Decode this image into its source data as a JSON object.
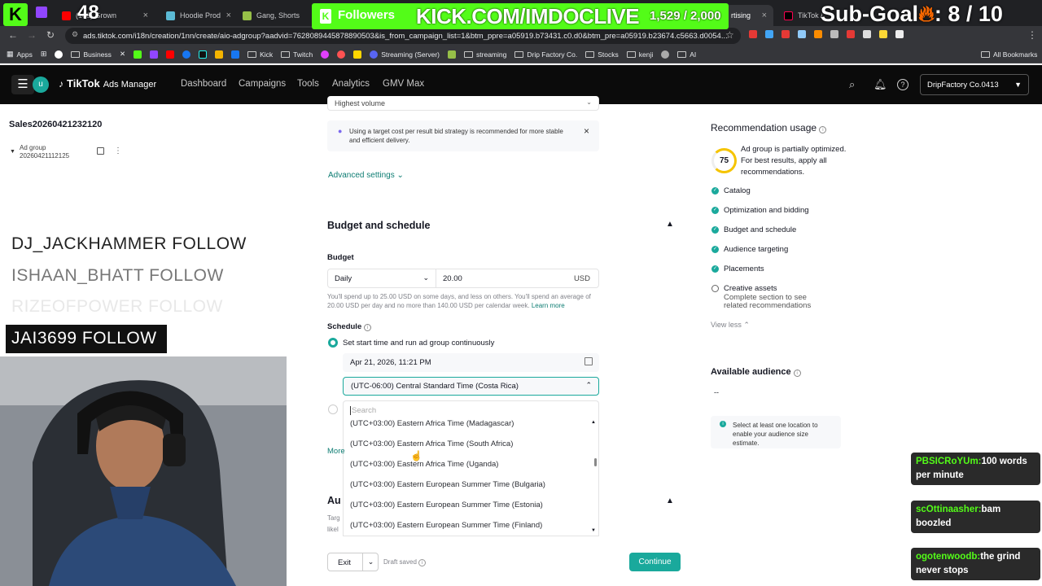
{
  "browser": {
    "tabs": [
      {
        "label": "(103) Grown",
        "color": "#ff0000"
      },
      {
        "label": "Hoodie Prod",
        "color": "#5bbad5"
      },
      {
        "label": "Gang, Shorts",
        "color": "#96bf48"
      },
      {
        "label": "rtising",
        "color": "#000000"
      },
      {
        "label": "TikTok Ad",
        "color": "#000000"
      }
    ],
    "url": "ads.tiktok.com/i18n/creation/1nn/create/aio-adgroup?aadvid=7628089445878890503&is_from_campaign_list=1&btm_ppre=a05919.b73431.c0.d0&btm_pre=a05919.b23674.c5663.d0054...",
    "bookmarks": [
      "Apps",
      "Business",
      "Kick",
      "Twitch",
      "Streaming (Server)",
      "streaming",
      "Drip Factory Co.",
      "Stocks",
      "kenji",
      "AI"
    ],
    "all_bookmarks": "All Bookmarks"
  },
  "stream_overlay": {
    "kick_count": "48",
    "followers_label": "Followers",
    "url": "KICK.COM/IMDOCLIVE",
    "followers_count": "1,529 / 2,000",
    "subgoal_label": "Sub-Goal",
    "subgoal_count": ": 8 / 10",
    "follows": [
      "DJ_JACKHAMMER  FOLLOW",
      "ISHAAN_BHATT  FOLLOW",
      "RIZEOFPOWER  FOLLOW",
      "JAI3699  FOLLOW"
    ],
    "chat": [
      {
        "user": "PBSICRoYUm:",
        "msg": "100 words per minute"
      },
      {
        "user": "scOttinaasher:",
        "msg": "bam boozled"
      },
      {
        "user": "ogotenwoodb:",
        "msg": "the grind never stops"
      }
    ]
  },
  "app": {
    "brand": "TikTok",
    "brand_sub": "Ads Manager",
    "avatar_letter": "u",
    "nav": [
      "Dashboard",
      "Campaigns",
      "Tools",
      "Analytics",
      "GMV Max"
    ],
    "account": "DripFactory Co.0413"
  },
  "sidebar": {
    "campaign": "Sales20260421232120",
    "adgroup": "Ad group 20260421112125"
  },
  "form": {
    "top_select": "Highest volume",
    "bid_tip": "Using a target cost per result bid strategy is recommended for more stable and efficient delivery.",
    "advanced": "Advanced settings",
    "budget_section": "Budget and schedule",
    "budget_label": "Budget",
    "budget_type": "Daily",
    "budget_value": "20.00",
    "currency": "USD",
    "budget_note": "You'll spend up to 25.00 USD on some days, and less on others. You'll spend an average of 20.00 USD per day and no more than 140.00 USD per calendar week.",
    "learn_more": "Learn more",
    "schedule_label": "Schedule",
    "schedule_option1": "Set start time and run ad group continuously",
    "start_time": "Apr 21, 2026, 11:21 PM",
    "timezone": "(UTC-06:00) Central Standard Time (Costa Rica)",
    "search_placeholder": "Search",
    "timezone_options": [
      "(UTC+03:00) Eastern Africa Time (Madagascar)",
      "(UTC+03:00) Eastern Africa Time (South Africa)",
      "(UTC+03:00) Eastern Africa Time (Uganda)",
      "(UTC+03:00) Eastern European Summer Time (Bulgaria)",
      "(UTC+03:00) Eastern European Summer Time (Estonia)",
      "(UTC+03:00) Eastern European Summer Time (Finland)"
    ],
    "more": "More",
    "audience_partial": "Au",
    "target_partial": "Targ",
    "likely_partial": "likel"
  },
  "footer": {
    "exit": "Exit",
    "draft": "Draft saved",
    "continue": "Continue"
  },
  "recommendations": {
    "title": "Recommendation usage",
    "score": "75",
    "score_text": "Ad group is partially optimized. For best results, apply all recommendations.",
    "items": [
      "Catalog",
      "Optimization and bidding",
      "Budget and schedule",
      "Audience targeting",
      "Placements"
    ],
    "pending_item": "Creative assets",
    "pending_note": "Complete section to see related recommendations",
    "view_less": "View less",
    "audience_title": "Available audience",
    "audience_value": "--",
    "audience_note": "Select at least one location to enable your audience size estimate."
  },
  "colors": {
    "accent": "#1aa99c",
    "kick": "#53fc18",
    "header": "#0b0b0b"
  }
}
